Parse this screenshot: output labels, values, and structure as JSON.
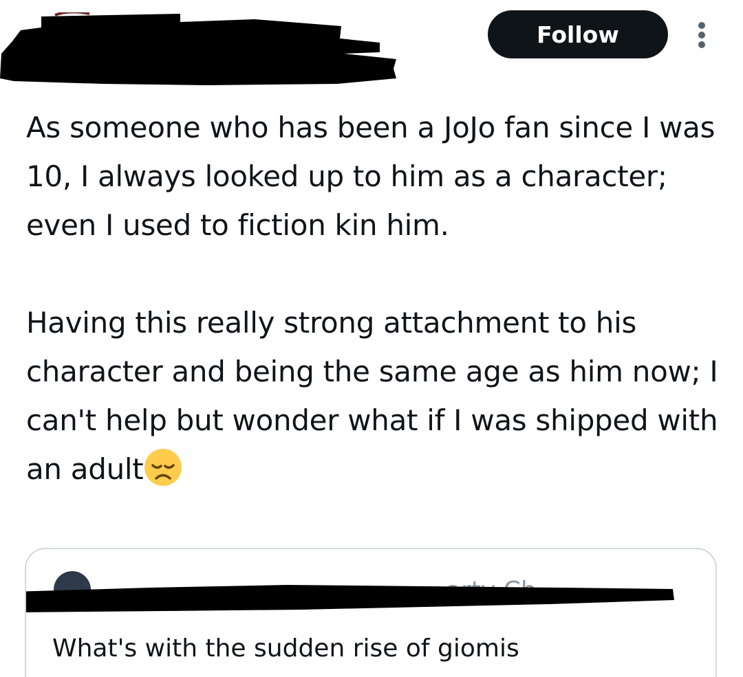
{
  "header": {
    "follow_label": "Follow",
    "more_icon": "more-options-icon",
    "avatar_icon": "avatar"
  },
  "tweet": {
    "paragraph_1": "As someone who has been a JoJo fan since I was 10, I always looked up to him as a character; even I used to fiction kin him.",
    "paragraph_2": "Having this really strong attachment to his character and being the same age as him now; I can't help but wonder what if I was shipped with an adult",
    "emoji": "disappointed-face-icon"
  },
  "quote": {
    "text": "What's with the sudden rise of giomis",
    "handle_fragment": "arty  Ch"
  },
  "colors": {
    "text": "#0f1419",
    "follow_bg": "#0f1419",
    "follow_text": "#ffffff",
    "border": "#cfd9de",
    "muted": "#8b98a5",
    "redaction": "#000000"
  }
}
